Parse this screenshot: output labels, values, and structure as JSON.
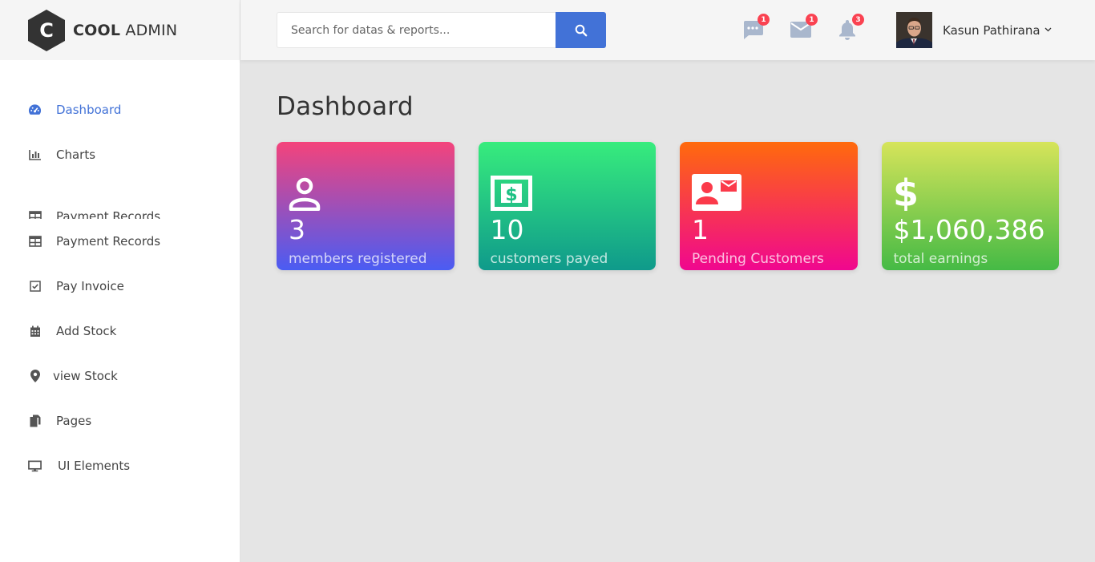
{
  "brand": {
    "bold": "COOL",
    "light": "ADMIN",
    "mark": "C"
  },
  "sidebar": {
    "items": [
      {
        "label": "Dashboard",
        "icon": "tachometer-icon",
        "active": true
      },
      {
        "label": "Charts",
        "icon": "bar-chart-icon"
      },
      {
        "label": "Payment Records",
        "icon": "table-icon",
        "clipped": true
      },
      {
        "label": "Payment Records",
        "icon": "table-icon"
      },
      {
        "label": "Pay Invoice",
        "icon": "check-square-icon"
      },
      {
        "label": "Add Stock",
        "icon": "calendar-icon"
      },
      {
        "label": "view Stock",
        "icon": "map-marker-icon"
      },
      {
        "label": "Pages",
        "icon": "copy-icon"
      },
      {
        "label": "UI Elements",
        "icon": "desktop-icon"
      }
    ]
  },
  "header": {
    "search": {
      "placeholder": "Search for datas & reports..."
    },
    "notifications": [
      {
        "icon": "comment-more-icon",
        "count": "1"
      },
      {
        "icon": "email-icon",
        "count": "1"
      },
      {
        "icon": "bell-icon",
        "count": "3"
      }
    ],
    "user": {
      "name": "Kasun Pathirana"
    }
  },
  "main": {
    "title": "Dashboard",
    "cards": [
      {
        "icon": "account-icon",
        "value": "3",
        "label": "members registered"
      },
      {
        "icon": "dollar-box-icon",
        "value": "10",
        "label": "customers payed"
      },
      {
        "icon": "contact-mail-icon",
        "value": "1",
        "label": "Pending Customers"
      },
      {
        "icon": "dollar-icon",
        "value": "$1,060,386",
        "label": "total earnings"
      }
    ]
  },
  "colors": {
    "accent": "#4272d7",
    "badge": "#fa4251"
  }
}
